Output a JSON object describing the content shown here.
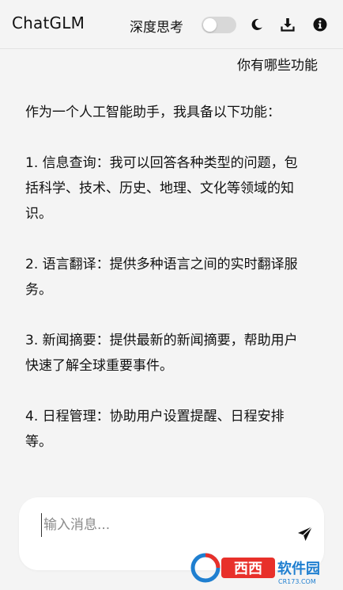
{
  "header": {
    "title": "ChatGLM",
    "deep_think_label": "深度思考",
    "deep_think_enabled": false,
    "icons": [
      "moon-icon",
      "download-icon",
      "info-icon"
    ]
  },
  "conversation": {
    "user_message": "你有哪些功能",
    "assistant_paragraphs": [
      "作为一个人工智能助手，我具备以下功能：",
      "1. 信息查询：我可以回答各种类型的问题，包括科学、技术、历史、地理、文化等领域的知识。",
      "2. 语言翻译：提供多种语言之间的实时翻译服务。",
      "3. 新闻摘要：提供最新的新闻摘要，帮助用户快速了解全球重要事件。",
      "4. 日程管理：协助用户设置提醒、日程安排等。"
    ]
  },
  "composer": {
    "placeholder": "输入消息...",
    "value": "",
    "send_icon": "send-icon"
  },
  "watermark": {
    "text": "西西软件园",
    "domain": "CR173.COM",
    "colors": {
      "red": "#e8302a",
      "blue": "#1f7fd0"
    }
  }
}
